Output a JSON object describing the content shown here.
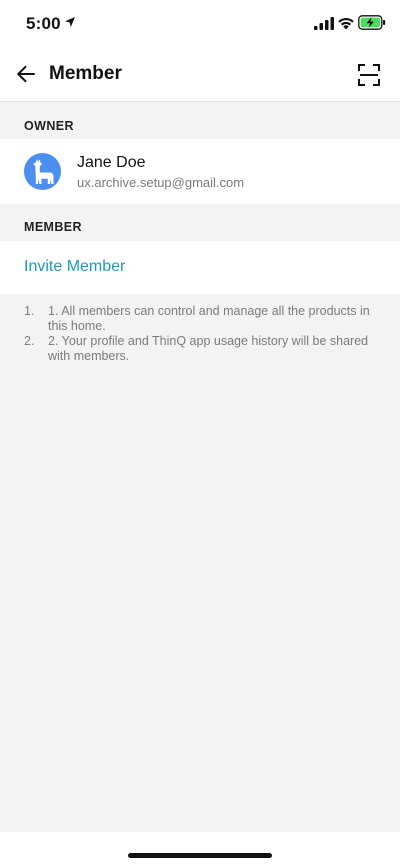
{
  "status_bar": {
    "time": "5:00"
  },
  "header": {
    "title": "Member"
  },
  "owner_section": {
    "label": "OWNER",
    "owner": {
      "name": "Jane Doe",
      "email": "ux.archive.setup@gmail.com"
    }
  },
  "member_section": {
    "label": "MEMBER",
    "invite_label": "Invite Member"
  },
  "notes": [
    {
      "number": "1.",
      "text": "1. All members can control and manage all the products in this home."
    },
    {
      "number": "2.",
      "text": "2. Your profile and ThinQ app usage history will be shared with members."
    }
  ],
  "colors": {
    "accent": "#1b9bb8",
    "avatar_bg": "#4c8ff0",
    "battery": "#4cd964"
  }
}
